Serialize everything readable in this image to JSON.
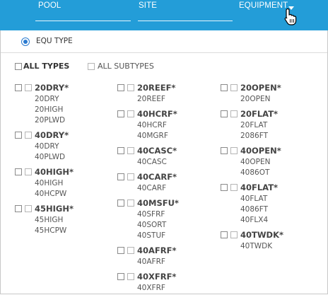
{
  "nav": {
    "tabs": [
      {
        "label": "POOL"
      },
      {
        "label": "SITE"
      },
      {
        "label": "EQUIPMENT"
      }
    ]
  },
  "panel": {
    "radio_label": "EQU TYPE",
    "all_types_label": "ALL TYPES",
    "all_subtypes_label": "ALL SUBTYPES",
    "columns": [
      [
        {
          "label": "20DRY*",
          "subtypes": [
            "20DRY",
            "20HIGH",
            "20PLWD"
          ]
        },
        {
          "label": "40DRY*",
          "subtypes": [
            "40DRY",
            "40PLWD"
          ]
        },
        {
          "label": "40HIGH*",
          "subtypes": [
            "40HIGH",
            "40HCPW"
          ]
        },
        {
          "label": "45HIGH*",
          "subtypes": [
            "45HIGH",
            "45HCPW"
          ]
        }
      ],
      [
        {
          "label": "20REEF*",
          "subtypes": [
            "20REEF"
          ]
        },
        {
          "label": "40HCRF*",
          "subtypes": [
            "40HCRF",
            "40MGRF"
          ]
        },
        {
          "label": "40CASC*",
          "subtypes": [
            "40CASC"
          ]
        },
        {
          "label": "40CARF*",
          "subtypes": [
            "40CARF"
          ]
        },
        {
          "label": "40MSFU*",
          "subtypes": [
            "40SFRF",
            "40SORT",
            "40STUF"
          ]
        },
        {
          "label": "40AFRF*",
          "subtypes": [
            "40AFRF"
          ]
        },
        {
          "label": "40XFRF*",
          "subtypes": [
            "40XFRF"
          ]
        }
      ],
      [
        {
          "label": "20OPEN*",
          "subtypes": [
            "20OPEN"
          ]
        },
        {
          "label": "20FLAT*",
          "subtypes": [
            "20FLAT",
            "2086FT"
          ]
        },
        {
          "label": "40OPEN*",
          "subtypes": [
            "40OPEN",
            "4086OT"
          ]
        },
        {
          "label": "40FLAT*",
          "subtypes": [
            "40FLAT",
            "4086FT",
            "40FLX4"
          ]
        },
        {
          "label": "40TWDK*",
          "subtypes": [
            "40TWDK"
          ]
        }
      ]
    ]
  },
  "colors": {
    "header_blue": "#239dd8",
    "radio_blue": "#2b7bd0"
  },
  "icons": [
    "caret-down-icon",
    "hand-pointer-cursor-icon",
    "radio-selected-icon",
    "checkbox-icon"
  ]
}
